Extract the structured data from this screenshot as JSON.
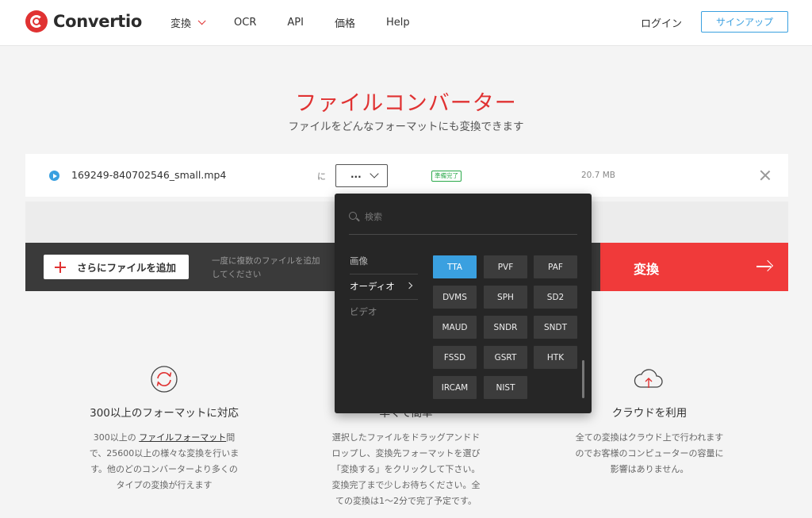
{
  "header": {
    "logo_text": "Convertio",
    "nav": [
      {
        "label": "変換"
      },
      {
        "label": "OCR"
      },
      {
        "label": "API"
      },
      {
        "label": "価格"
      },
      {
        "label": "Help"
      }
    ],
    "login_label": "ログイン",
    "signup_label": "サインアップ"
  },
  "hero": {
    "title": "ファイルコンバーター",
    "subtitle": "ファイルをどんなフォーマットにも変換できます"
  },
  "file": {
    "name": "169249-840702546_small.mp4",
    "to_label": "に",
    "format_placeholder": "...",
    "status": "準備完了",
    "size": "20.7 MB"
  },
  "actions": {
    "add_label": "さらにファイルを追加",
    "hint_line1": "一度に複数のファイルを追加",
    "hint_line2": "してください",
    "convert_label": "変換"
  },
  "dropdown": {
    "search_placeholder": "検索",
    "categories": [
      {
        "label": "画像"
      },
      {
        "label": "オーディオ"
      },
      {
        "label": "ビデオ"
      }
    ],
    "active_category": "オーディオ",
    "formats": [
      "TTA",
      "PVF",
      "PAF",
      "DVMS",
      "SPH",
      "SD2",
      "MAUD",
      "SNDR",
      "SNDT",
      "FSSD",
      "GSRT",
      "HTK",
      "IRCAM",
      "NIST"
    ],
    "selected_format": "TTA"
  },
  "features": [
    {
      "title": "300以上のフォーマットに対応",
      "desc_line1_pre": "300以上の ",
      "desc_line1_link": "ファイルフォーマット",
      "desc_line1_post": "間",
      "desc_line2": "で、25600以上の様々な変換を行いま",
      "desc_line3": "す。他のどのコンバーターより多くの",
      "desc_line4": "タイプの変換が行えます"
    },
    {
      "title": "早くて簡単",
      "desc_line1": "選択したファイルをドラッグアンドド",
      "desc_line2": "ロップし、変換先フォーマットを選び",
      "desc_line3": "「変換する」をクリックして下さい。",
      "desc_line4": "変換完了まで少しお待ちください。全",
      "desc_line5": "ての変換は1〜2分で完了予定です。"
    },
    {
      "title": "クラウドを利用",
      "desc_line1": "全ての変換はクラウド上で行われます",
      "desc_line2": "のでお客様のコンピューターの容量に",
      "desc_line3": "影響はありません。"
    }
  ],
  "colors": {
    "brand_red": "#e03232",
    "accent_blue": "#3aa0e0",
    "ready_green": "#2aa84a"
  }
}
